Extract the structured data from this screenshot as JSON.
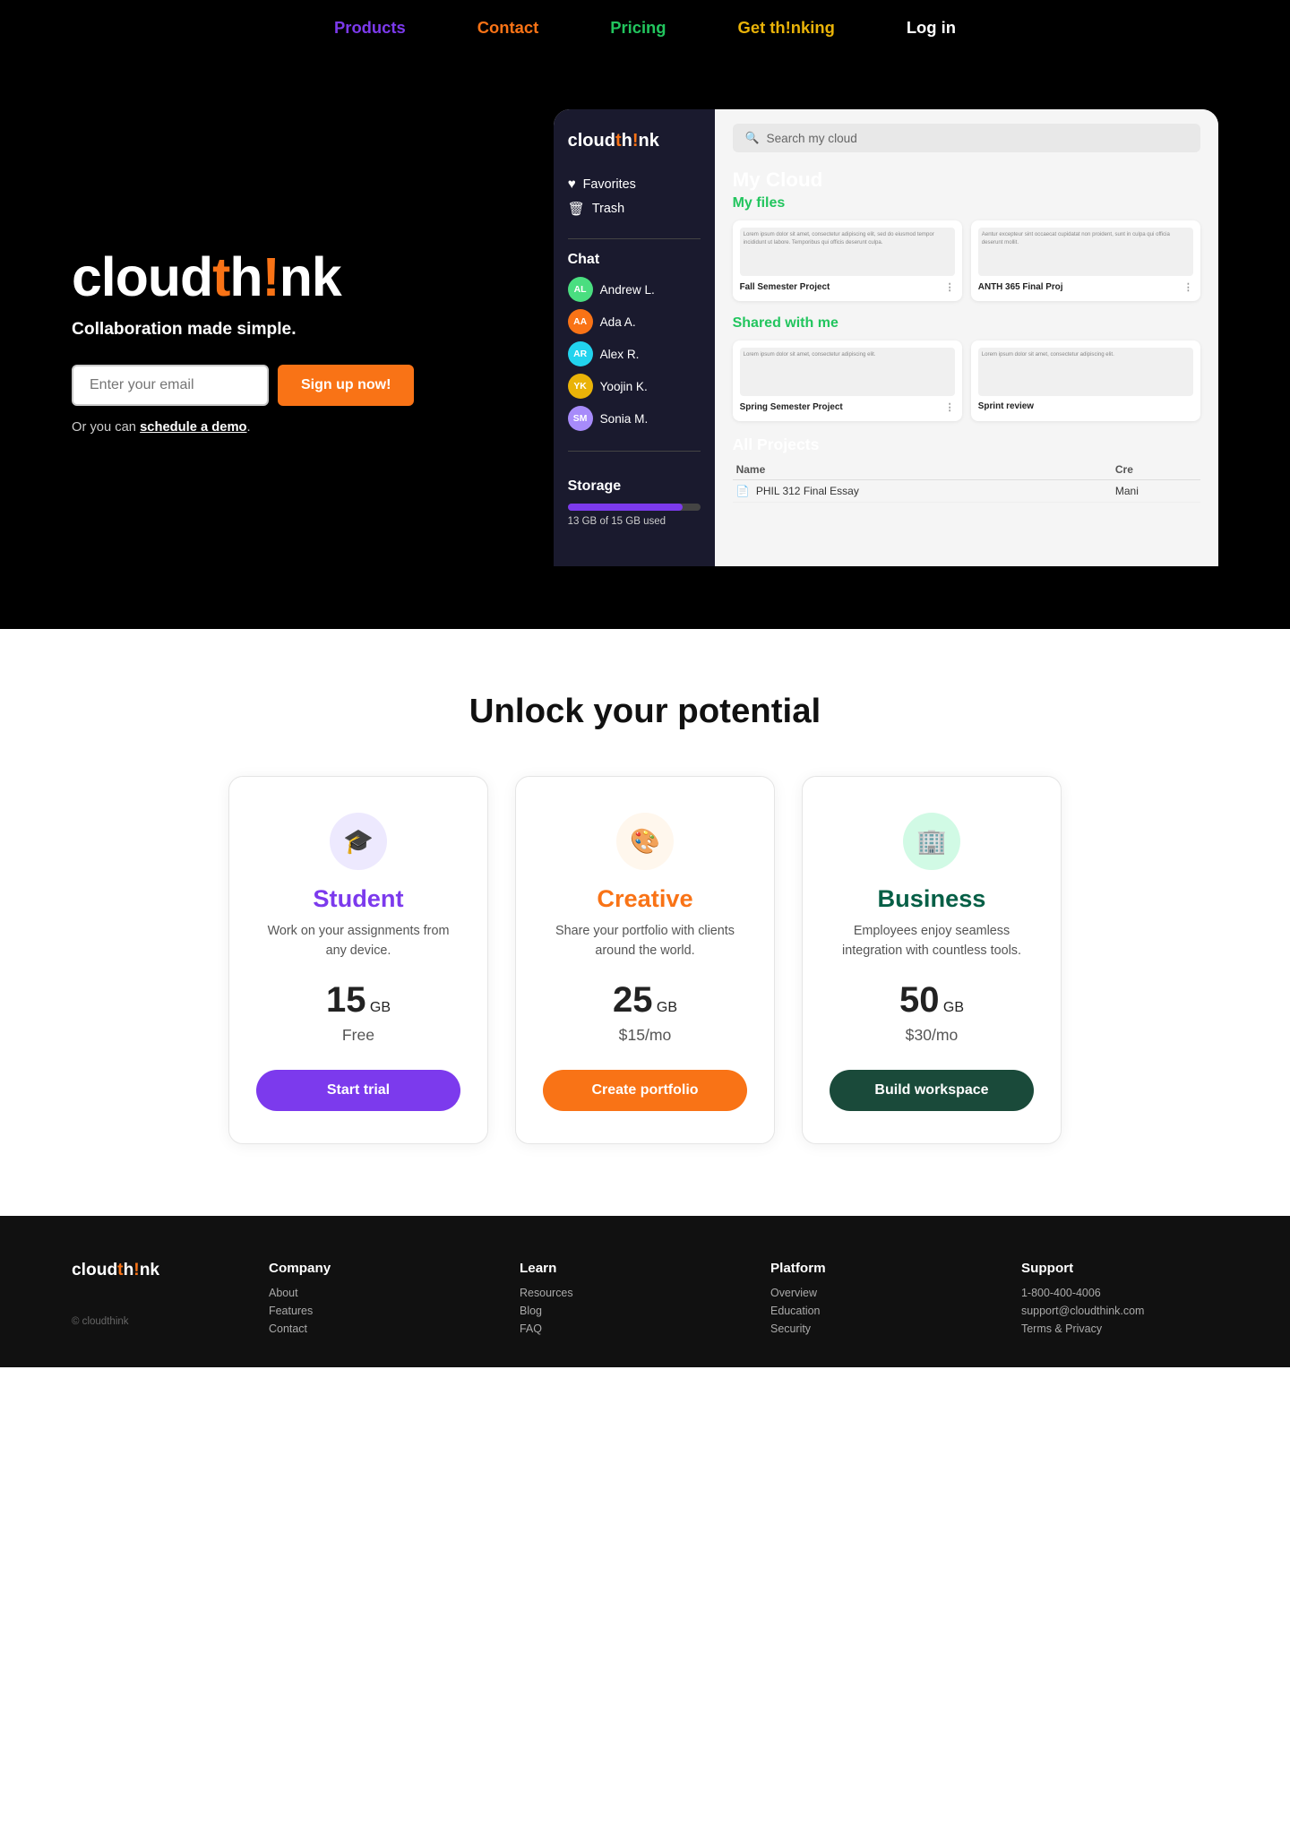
{
  "nav": {
    "products": "Products",
    "contact": "Contact",
    "pricing": "Pricing",
    "thinking": "Get th!nking",
    "login": "Log in"
  },
  "hero": {
    "logo": "cloudth!nk",
    "tagline": "Collaboration made simple.",
    "email_placeholder": "Enter your email",
    "signup_btn": "Sign up now!",
    "demo_text": "Or you can",
    "demo_link": "schedule a demo",
    "demo_period": "."
  },
  "mockup": {
    "brand": "cloudth!nk",
    "search_placeholder": "Search my cloud",
    "sidebar": {
      "favorites": "Favorites",
      "trash": "Trash",
      "chat_label": "Chat",
      "members": [
        {
          "initials": "AL",
          "name": "Andrew L.",
          "color": "#4ade80"
        },
        {
          "initials": "AA",
          "name": "Ada A.",
          "color": "#f97316"
        },
        {
          "initials": "AR",
          "name": "Alex R.",
          "color": "#22d3ee"
        },
        {
          "initials": "YK",
          "name": "Yoojin K.",
          "color": "#eab308"
        },
        {
          "initials": "SM",
          "name": "Sonia M.",
          "color": "#a78bfa"
        }
      ],
      "storage_label": "Storage",
      "storage_used": "13 GB of 15 GB used",
      "storage_pct": 87
    },
    "cloud_title": "My Cloud",
    "my_files_label": "My files",
    "shared_label": "Shared with me",
    "files": [
      {
        "name": "Fall Semester Project",
        "preview": "Lorem ipsum dolor sit amet, consectetur adipiscing elit, sed do eiusmod tempor incididunt ut..."
      },
      {
        "name": "ANTH 365 Final Proj",
        "preview": "Aentur excepteur sint occaecat cupidatat non proident, sunt in culpa qui officia deserunt mollit."
      }
    ],
    "shared_files": [
      {
        "name": "Spring Semester Project",
        "preview": "Lorem ipsum dolor sit amet, consectetur adipiscing elit."
      },
      {
        "name": "Sprint review",
        "preview": "Lorem ipsum dolor sit amet, consectetur adipiscing elit."
      }
    ],
    "all_projects_title": "All Projects",
    "table_headers": [
      "Name",
      "Cre"
    ],
    "projects": [
      {
        "name": "PHIL 312 Final Essay",
        "created": "Mani"
      }
    ]
  },
  "pricing": {
    "section_title": "Unlock your potential",
    "plans": [
      {
        "id": "student",
        "icon": "🎓",
        "icon_bg": "#ede9fe",
        "name": "Student",
        "name_color": "#7c3aed",
        "desc": "Work on your assignments from any device.",
        "storage_num": "15",
        "storage_unit": "GB",
        "price": "Free",
        "btn_label": "Start trial",
        "btn_class": "btn-student"
      },
      {
        "id": "creative",
        "icon": "🎨",
        "icon_bg": "#fff7ed",
        "name": "Creative",
        "name_color": "#f97316",
        "desc": "Share your portfolio with clients around the world.",
        "storage_num": "25",
        "storage_unit": "GB",
        "price": "$15/mo",
        "btn_label": "Create portfolio",
        "btn_class": "btn-creative"
      },
      {
        "id": "business",
        "icon": "🏢",
        "icon_bg": "#d1fae5",
        "name": "Business",
        "name_color": "#065f46",
        "desc": "Employees enjoy seamless integration with countless tools.",
        "storage_num": "50",
        "storage_unit": "GB",
        "price": "$30/mo",
        "btn_label": "Build workspace",
        "btn_class": "btn-business"
      }
    ]
  },
  "footer": {
    "logo": "cloudth!nk",
    "copyright": "© cloudthink",
    "columns": [
      {
        "title": "Company",
        "links": [
          "About",
          "Features",
          "Contact"
        ]
      },
      {
        "title": "Learn",
        "links": [
          "Resources",
          "Blog",
          "FAQ"
        ]
      },
      {
        "title": "Platform",
        "links": [
          "Overview",
          "Education",
          "Security"
        ]
      },
      {
        "title": "Support",
        "links": [
          "1-800-400-4006",
          "support@cloudthink.com",
          "Terms & Privacy"
        ]
      }
    ]
  }
}
